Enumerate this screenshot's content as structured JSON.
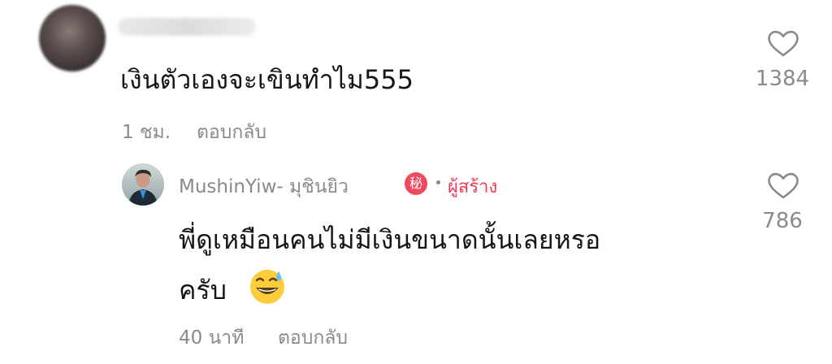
{
  "comment": {
    "text": "เงินตัวเองจะเขินทำไม555",
    "time": "1 ชม.",
    "reply_label": "ตอบกลับ",
    "likes": "1384"
  },
  "reply": {
    "author": "MushinYiw- มุชินยิว",
    "badge_text": "秘",
    "creator_label": "ผู้สร้าง",
    "text_line1": "พี่ดูเหมือนคนไม่มีเงินขนาดนั้นเลยหรอ",
    "text_line2": "ครับ",
    "time": "40 นาที",
    "reply_label": "ตอบกลับ",
    "likes": "786"
  },
  "icons": {
    "like": "heart-outline-icon",
    "emoji": "grinning-face-with-sweat-emoji"
  },
  "colors": {
    "primary_text": "#161616",
    "secondary_text": "#8a8a8a",
    "creator_accent": "#f03a58",
    "badge_bg": "#f04a5c"
  }
}
